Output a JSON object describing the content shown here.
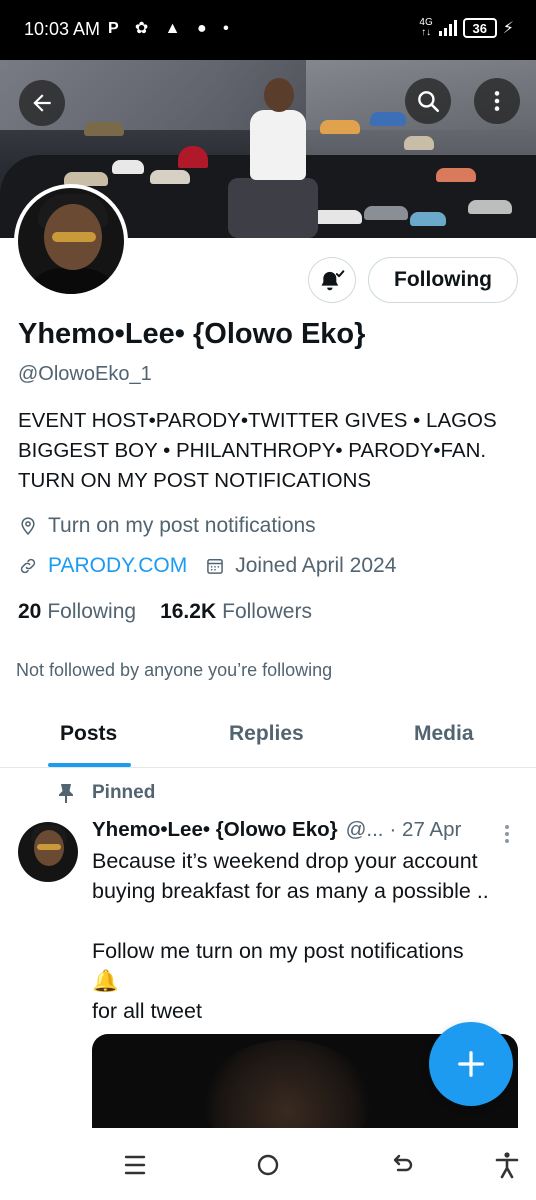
{
  "status_bar": {
    "time": "10:03 AM",
    "notif_icons": "P ✿ ▲ ● •",
    "network": "4G",
    "battery": "36"
  },
  "colors": {
    "accent": "#1d9bf0",
    "text_primary": "#0f1419",
    "text_secondary": "#536471",
    "border": "#cfd9de"
  },
  "header": {
    "back_icon": "arrow-left-icon",
    "search_icon": "search-icon",
    "more_icon": "more-vertical-icon"
  },
  "profile": {
    "notify_icon": "bell-subscribed-icon",
    "following_label": "Following",
    "display_name": "Yhemo•Lee• {Olowo Eko}",
    "handle": "@OlowoEko_1",
    "bio_lines": [
      "EVENT HOST•PARODY•TWITTER GIVES • LAGOS",
      "BIGGEST BOY • PHILANTHROPY• PARODY•FAN.",
      "TURN ON MY POST NOTIFICATIONS"
    ],
    "location": "Turn on my post notifications",
    "website": "PARODY.COM",
    "joined": "Joined April 2024",
    "following_count": "20",
    "following_text": "Following",
    "followers_count": "16.2K",
    "followers_text": "Followers",
    "not_followed": "Not followed by anyone you’re following"
  },
  "tabs": [
    {
      "label": "Posts",
      "active": true
    },
    {
      "label": "Replies",
      "active": false
    },
    {
      "label": "Media",
      "active": false
    }
  ],
  "tweet": {
    "pinned_label": "Pinned",
    "name": "Yhemo•Lee• {Olowo Eko}",
    "handle": "@...",
    "date": "· 27 Apr",
    "lines": [
      "Because it’s weekend drop your account",
      "buying breakfast for as many a possible ..",
      "",
      "Follow me turn on my post notifications",
      "🔔",
      "for all tweet"
    ]
  },
  "fab": {
    "icon": "plus-icon"
  },
  "navbar": {
    "items": [
      "recent-apps-icon",
      "home-icon",
      "back-icon",
      "accessibility-icon"
    ]
  }
}
